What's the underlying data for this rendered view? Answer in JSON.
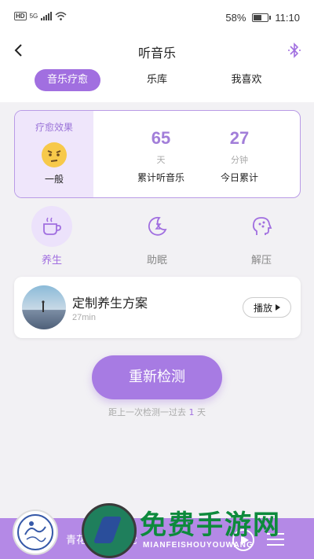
{
  "status_bar": {
    "hd": "HD",
    "network": "5G",
    "battery": "58%",
    "battery_level": 0.58,
    "time": "11:10"
  },
  "header": {
    "title": "听音乐"
  },
  "tabs": [
    {
      "label": "音乐疗愈",
      "active": true
    },
    {
      "label": "乐库",
      "active": false
    },
    {
      "label": "我喜欢",
      "active": false
    }
  ],
  "stats": {
    "effect_label": "疗愈效果",
    "effect_value": "一般",
    "total": {
      "value": "65",
      "unit": "天",
      "label": "累计听音乐"
    },
    "today": {
      "value": "27",
      "unit": "分钟",
      "label": "今日累计"
    }
  },
  "categories": [
    {
      "label": "养生",
      "icon": "teacup-icon",
      "active": true
    },
    {
      "label": "助眠",
      "icon": "moon-sleep-icon",
      "active": false
    },
    {
      "label": "解压",
      "icon": "head-relax-icon",
      "active": false
    }
  ],
  "plan": {
    "title": "定制养生方案",
    "duration": "27min",
    "play_label": "播放"
  },
  "redetect": {
    "label": "重新检测",
    "last_prefix": "距上一次检测一过去",
    "days": "1",
    "days_unit": "天"
  },
  "player": {
    "song": "青花瓷 - 周杰伦"
  },
  "watermark": {
    "text": "免费手游网",
    "sub": "MIANFEISHOUYOUWANG"
  },
  "colors": {
    "accent": "#a16fe0",
    "accent_light": "#efe6fb",
    "stat_number": "#a27ed9",
    "player_bar": "#b489e6"
  }
}
